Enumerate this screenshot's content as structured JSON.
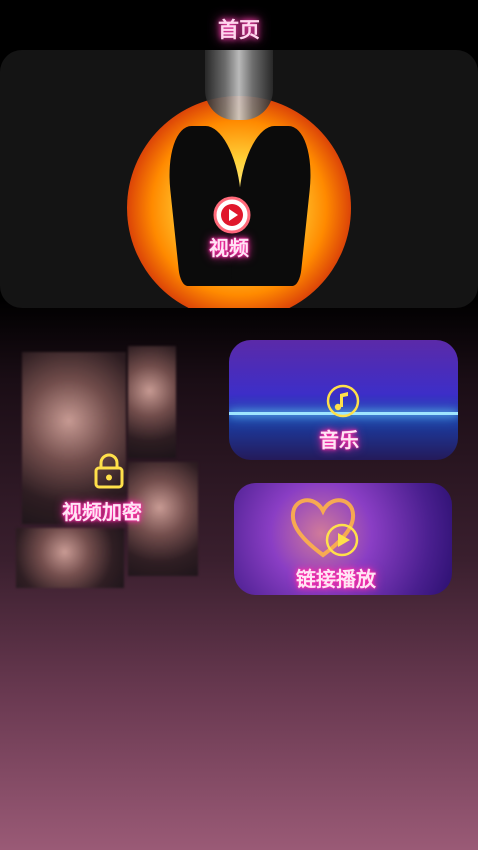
{
  "header": {
    "title": "首页"
  },
  "hero": {
    "label": "视频",
    "icon": "play-circle-icon"
  },
  "tiles": {
    "encrypted": {
      "label": "视频加密",
      "icon": "lock-icon"
    },
    "music": {
      "label": "音乐",
      "icon": "music-note-icon"
    },
    "link_play": {
      "label": "链接播放",
      "icon": "play-circle-icon"
    }
  },
  "colors": {
    "neon_pink": "#ff2fa8",
    "neon_yellow": "#ffe04a",
    "play_red": "#e0172c"
  }
}
